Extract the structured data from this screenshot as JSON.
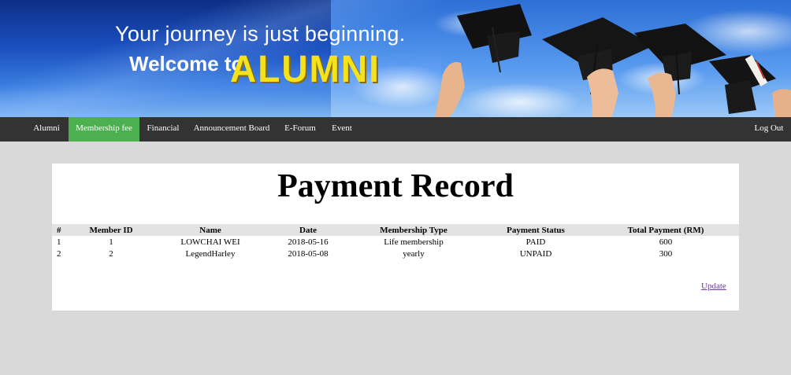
{
  "banner": {
    "tagline": "Your  journey is just beginning.",
    "welcome": "Welcome to",
    "brand": "ALUMNI"
  },
  "nav": {
    "items": [
      "Alumni",
      "Membership fee",
      "Financial",
      "Announcement Board",
      "E-Forum",
      "Event"
    ],
    "active": "Membership fee",
    "logout": "Log Out",
    "active_color": "#4caf50",
    "bar_color": "#333333"
  },
  "page": {
    "title": "Payment Record",
    "update_link": "Update"
  },
  "table": {
    "headers": [
      "#",
      "Member ID",
      "Name",
      "Date",
      "Membership Type",
      "Payment Status",
      "Total Payment (RM)"
    ],
    "rows": [
      [
        "1",
        "1",
        "LOWCHAI WEI",
        "2018-05-16",
        "Life membership",
        "PAID",
        "600"
      ],
      [
        "2",
        "2",
        "LegendHarley",
        "2018-05-08",
        "yearly",
        "UNPAID",
        "300"
      ]
    ]
  }
}
